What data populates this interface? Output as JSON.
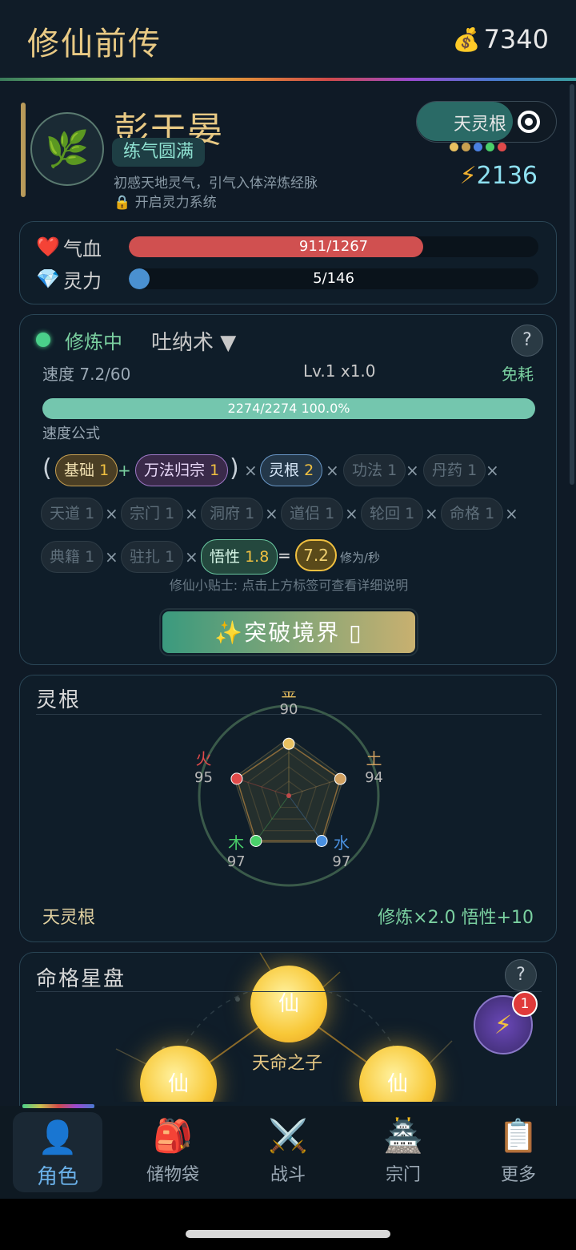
{
  "app": {
    "title": "修仙前传",
    "coins": "7340"
  },
  "character": {
    "name": "彭于晏",
    "realm": "练气圆满",
    "description": "初感天地灵气，引气入体淬炼经脉",
    "unlock": "开启灵力系统",
    "toggle_label": "天灵根",
    "power": "2136",
    "dot_colors": [
      "#e8c060",
      "#c8a050",
      "#4a80e0",
      "#4ad06a",
      "#e04a4a"
    ]
  },
  "stats": {
    "hp": {
      "label": "气血",
      "text": "911/1267",
      "current": 911,
      "max": 1267
    },
    "mp": {
      "label": "灵力",
      "text": "5/146",
      "current": 5,
      "max": 146
    }
  },
  "cultivation": {
    "status": "修炼中",
    "technique": "吐纳术 ▼",
    "help": "?",
    "speed": "速度 7.2/60",
    "level": "Lv.1 x1.0",
    "cost": "免耗",
    "progress_text": "2274/2274  100.0%",
    "progress": 1.0,
    "formula_title": "速度公式",
    "tags": {
      "base": {
        "label": "基础",
        "value": "1"
      },
      "method": {
        "label": "万法归宗",
        "value": "1"
      },
      "root": {
        "label": "灵根",
        "value": "2"
      },
      "gongfa": {
        "label": "功法",
        "value": "1"
      },
      "danyao": {
        "label": "丹药",
        "value": "1"
      },
      "tiandao": {
        "label": "天道",
        "value": "1"
      },
      "zongmen": {
        "label": "宗门",
        "value": "1"
      },
      "dongfu": {
        "label": "洞府",
        "value": "1"
      },
      "daolv": {
        "label": "道侣",
        "value": "1"
      },
      "lunhui": {
        "label": "轮回",
        "value": "1"
      },
      "mingge": {
        "label": "命格",
        "value": "1"
      },
      "dianji": {
        "label": "典籍",
        "value": "1"
      },
      "zhuzha": {
        "label": "驻扎",
        "value": "1"
      },
      "wuxing": {
        "label": "悟性",
        "value": "1.8"
      }
    },
    "result": "7.2",
    "result_unit": "修为/秒",
    "tip": "修仙小贴士: 点击上方标签可查看详细说明",
    "breakthrough": "✨突破境界 ▯"
  },
  "spirit_root": {
    "title": "灵根",
    "elements": [
      {
        "name": "金",
        "value": 90,
        "color": "#e8c060"
      },
      {
        "name": "土",
        "value": 94,
        "color": "#d0a060"
      },
      {
        "name": "水",
        "value": 97,
        "color": "#4a90e0"
      },
      {
        "name": "木",
        "value": 97,
        "color": "#4ad06a"
      },
      {
        "name": "火",
        "value": 95,
        "color": "#e04a4a"
      }
    ],
    "type_name": "天灵根",
    "bonus": "修炼×2.0  悟性+10"
  },
  "destiny": {
    "title": "命格星盘",
    "help": "?",
    "orb_label": "仙",
    "main_name": "天命之子"
  },
  "fab": {
    "badge": "1"
  },
  "nav": [
    {
      "label": "角色",
      "icon": "👤"
    },
    {
      "label": "储物袋",
      "icon": "🎒"
    },
    {
      "label": "战斗",
      "icon": "⚔️"
    },
    {
      "label": "宗门",
      "icon": "🏯"
    },
    {
      "label": "更多",
      "icon": "📋"
    }
  ]
}
